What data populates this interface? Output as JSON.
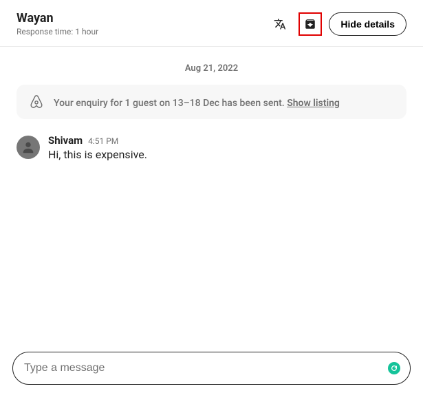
{
  "header": {
    "host_name": "Wayan",
    "response_time": "Response time: 1 hour",
    "hide_details_label": "Hide details"
  },
  "date_separator": "Aug 21, 2022",
  "enquiry": {
    "text": "Your enquiry for 1 guest on 13–18 Dec has been sent. ",
    "show_listing_label": "Show listing"
  },
  "message": {
    "sender": "Shivam",
    "time": "4:51 PM",
    "body": "Hi, this is expensive."
  },
  "composer": {
    "placeholder": "Type a message"
  },
  "icons": {
    "translate": "translate-icon",
    "archive": "archive-icon",
    "logo": "airbnb-logo-icon",
    "avatar": "person-icon",
    "grammarly": "grammarly-icon"
  }
}
